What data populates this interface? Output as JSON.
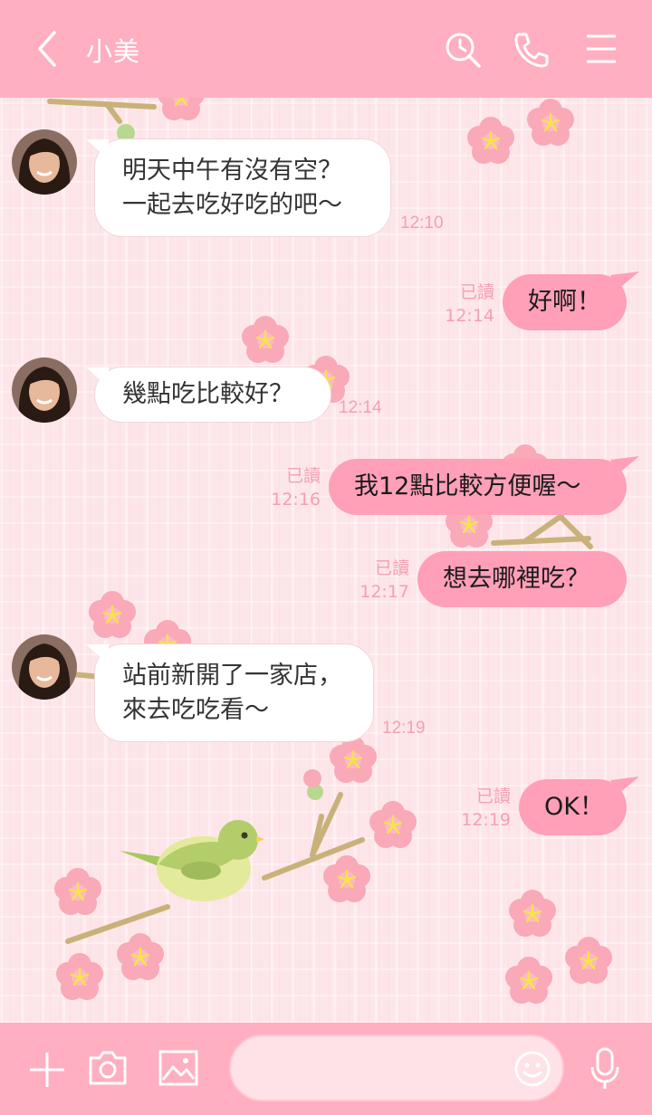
{
  "header": {
    "title": "小美",
    "icons": [
      "back-chevron-icon",
      "search-clock-icon",
      "phone-icon",
      "menu-icon"
    ]
  },
  "messages": [
    {
      "side": "in",
      "text": "明天中午有沒有空？\n一起去吃好吃的吧〜",
      "time": "12:10"
    },
    {
      "side": "out",
      "text": "好啊！",
      "read": "已讀",
      "time": "12:14"
    },
    {
      "side": "in",
      "text": "幾點吃比較好？",
      "time": "12:14"
    },
    {
      "side": "out",
      "text": "我12點比較方便喔〜",
      "read": "已讀",
      "time": "12:16"
    },
    {
      "side": "out",
      "text": "想去哪裡吃？",
      "read": "已讀",
      "time": "12:17"
    },
    {
      "side": "in",
      "text": "站前新開了一家店，\n來去吃吃看〜",
      "time": "12:19"
    },
    {
      "side": "out",
      "text": "OK！",
      "read": "已讀",
      "time": "12:19"
    }
  ],
  "footer": {
    "input_value": "",
    "icons": [
      "plus-icon",
      "camera-icon",
      "image-icon",
      "emoji-icon",
      "mic-icon"
    ]
  },
  "colors": {
    "header": "#ffafc0",
    "background": "#fde6e9",
    "outgoing_bubble": "#ff9fb8",
    "incoming_bubble": "#ffffff",
    "timestamp": "#f59fb3"
  }
}
